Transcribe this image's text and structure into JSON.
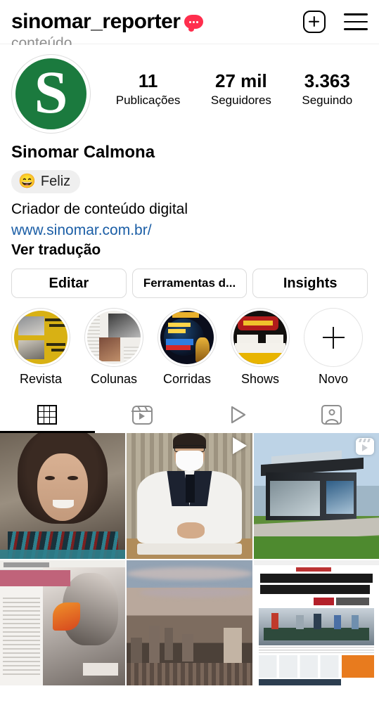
{
  "header": {
    "username": "sinomar_reporter",
    "note_badge_icon": "note-dots-badge",
    "create_icon": "plus-square-icon",
    "menu_icon": "hamburger-menu-icon"
  },
  "cut_off_text": "conteúdo.",
  "profile": {
    "avatar_letter": "S",
    "avatar_color": "#1b7a3e",
    "stats": [
      {
        "num": "11",
        "label": "Publicações"
      },
      {
        "num": "27 mil",
        "label": "Seguidores"
      },
      {
        "num": "3.363",
        "label": "Seguindo"
      }
    ],
    "full_name": "Sinomar Calmona",
    "status": {
      "emoji": "😄",
      "text": "Feliz"
    },
    "bio": "Criador de conteúdo digital",
    "link": "www.sinomar.com.br/",
    "link_color": "#1b5ea6",
    "translate": "Ver tradução"
  },
  "actions": [
    {
      "label": "Editar",
      "name": "edit-profile-button"
    },
    {
      "label": "Ferramentas d...",
      "name": "tools-button"
    },
    {
      "label": "Insights",
      "name": "insights-button"
    }
  ],
  "highlights": [
    {
      "label": "Revista",
      "art": "art-revista"
    },
    {
      "label": "Colunas",
      "art": "art-colunas"
    },
    {
      "label": "Corridas",
      "art": "art-corridas"
    },
    {
      "label": "Shows",
      "art": "art-shows"
    },
    {
      "label": "Novo",
      "art": "new"
    }
  ],
  "tabs": [
    {
      "name": "tab-grid",
      "icon": "grid-icon",
      "active": true
    },
    {
      "name": "tab-reels",
      "icon": "reels-icon",
      "active": false
    },
    {
      "name": "tab-video",
      "icon": "play-outline-icon",
      "active": false
    },
    {
      "name": "tab-tagged",
      "icon": "tagged-person-icon",
      "active": false
    }
  ],
  "posts": [
    {
      "name": "post-woman-portrait",
      "art": "post-portrait",
      "badge": "none"
    },
    {
      "name": "post-doctor-video",
      "art": "post-doctor",
      "badge": "play"
    },
    {
      "name": "post-sales-kiosk-reel",
      "art": "post-kiosk",
      "badge": "reels"
    },
    {
      "name": "post-magazine-modelo-internacional",
      "art": "post-magazine",
      "badge": "none"
    },
    {
      "name": "post-city-skyline",
      "art": "post-city",
      "badge": "none"
    },
    {
      "name": "post-newspaper-front-page",
      "art": "post-news",
      "badge": "none"
    }
  ]
}
